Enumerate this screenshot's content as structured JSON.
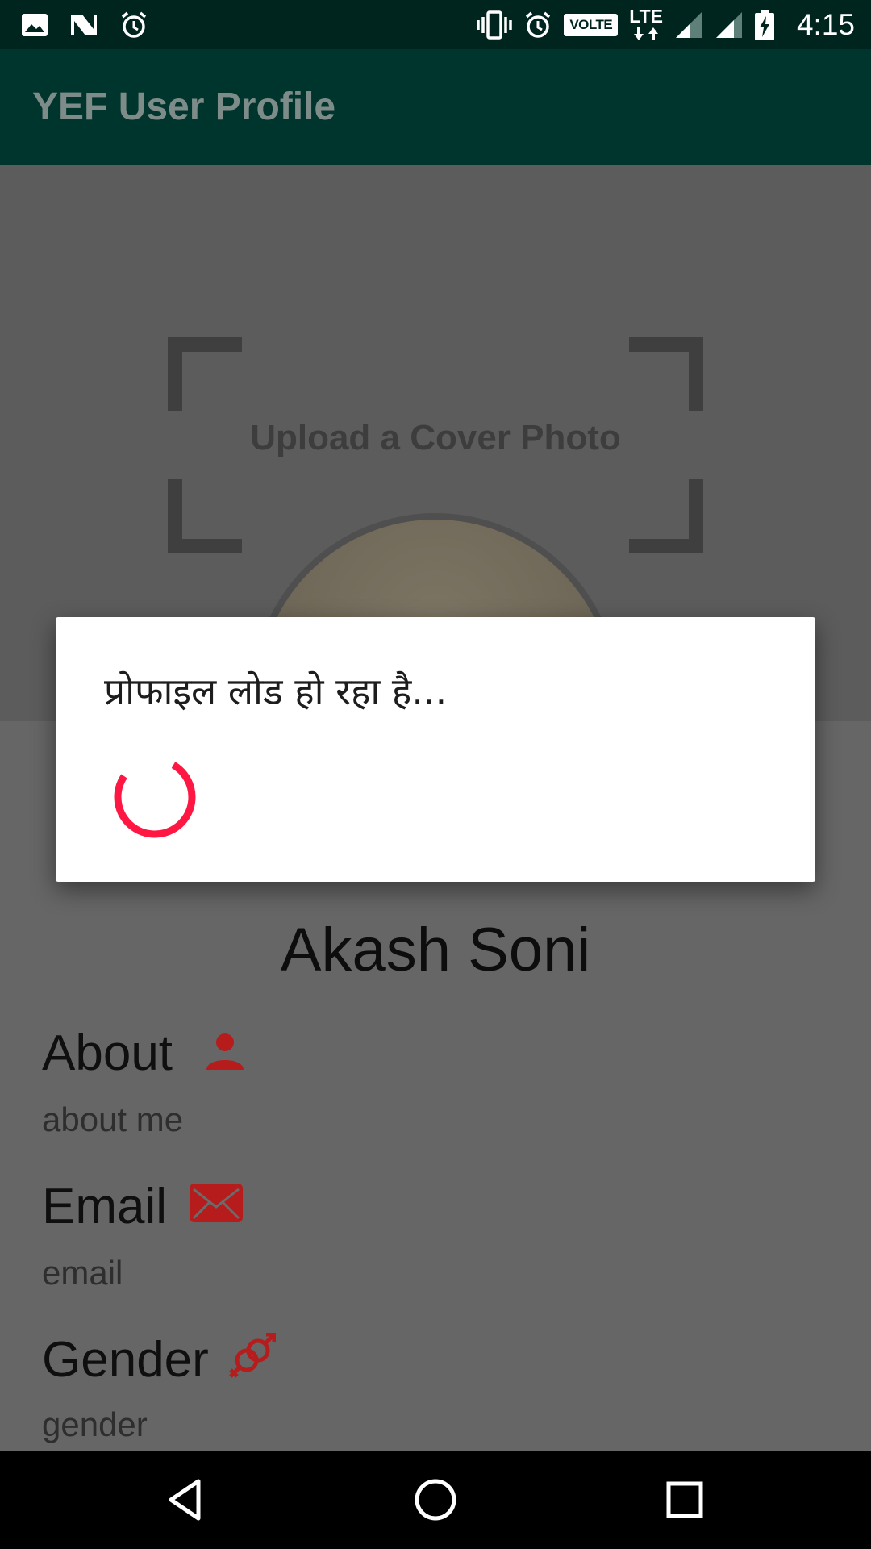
{
  "status_bar": {
    "time": "4:15",
    "volte_label": "VOLTE",
    "lte_label": "LTE",
    "icons_left": [
      "image-icon",
      "n-notification-icon",
      "alarm-clock-icon"
    ],
    "icons_right": [
      "vibrate-icon",
      "alarm-clock-icon",
      "volte-badge",
      "lte-data-icon",
      "signal-icon",
      "signal-icon",
      "battery-charging-icon"
    ]
  },
  "app_bar": {
    "title": "YEF User Profile"
  },
  "cover": {
    "label": "Upload a Cover Photo"
  },
  "profile": {
    "name": "Akash Soni",
    "fields": [
      {
        "label": "About",
        "value": "about me",
        "icon": "person-icon"
      },
      {
        "label": "Email",
        "value": "email",
        "icon": "mail-icon"
      },
      {
        "label": "Gender",
        "value": "gender",
        "icon": "gender-icon"
      }
    ]
  },
  "dialog": {
    "message": "प्रोफाइल लोड हो रहा है..."
  },
  "colors": {
    "status_bar": "#00251f",
    "app_bar": "#00352d",
    "accent_icon": "#b71c1c",
    "spinner": "#ff1744",
    "scrim_content": "#666666"
  },
  "nav_bar": {
    "buttons": [
      "back-icon",
      "home-icon",
      "recents-icon"
    ]
  }
}
